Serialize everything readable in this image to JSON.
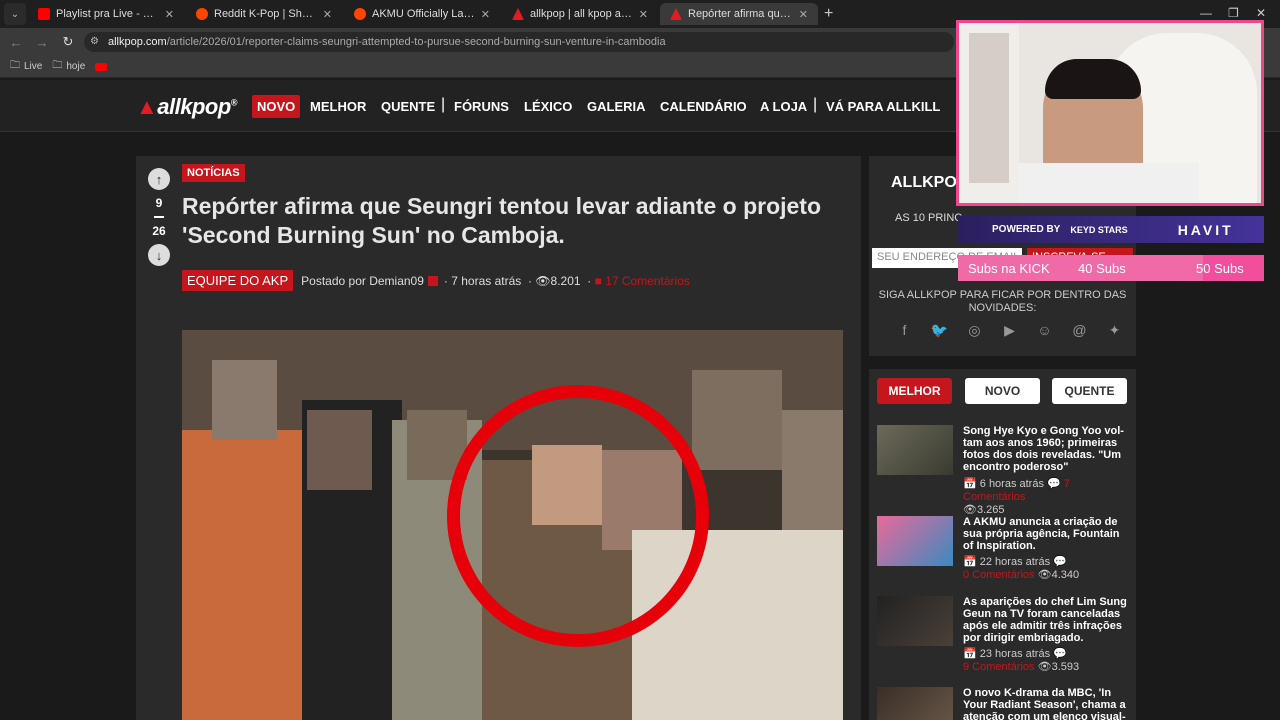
{
  "browser": {
    "tabs": [
      {
        "title": "Playlist pra Live - YouTube",
        "favicon_color": "#ff0000"
      },
      {
        "title": "Reddit K-Pop | Share and disco",
        "favicon_color": "#ff4500"
      },
      {
        "title": "AKMU Officially Launches One",
        "favicon_color": "#ff4500"
      },
      {
        "title": "allkpop | all kpop all the time",
        "favicon_color": "#e31b23"
      },
      {
        "title": "Repórter afirma que Seungri te",
        "favicon_color": "#e31b23"
      }
    ],
    "new_tab": "+",
    "url_domain": "allkpop.com",
    "url_path": "/article/2026/01/reporter-claims-seungri-attempted-to-pursue-second-burning-sun-venture-in-cambodia",
    "bookmarks": [
      {
        "label": "Live",
        "icon": "folder-icon"
      },
      {
        "label": "hoje",
        "icon": "folder-icon"
      },
      {
        "label": "",
        "icon": "youtube-icon"
      }
    ]
  },
  "site": {
    "logo": "allkpop",
    "nav": [
      "NOVO",
      "MELHOR",
      "QUENTE",
      "FÓRUNS",
      "LÉXICO",
      "GALERIA",
      "CALENDÁRIO",
      "A LOJA",
      "VÁ PARA ALLKILL"
    ],
    "accent": "#c4161c"
  },
  "article": {
    "category": "NOTÍCIAS",
    "votes_up": "9",
    "votes_down": "26",
    "title": "Repórter afirma que Seungri tentou levar adiante o projeto 'Second Burning Sun' no Camboja.",
    "team": "EQUIPE DO AKP",
    "posted_by": "Postado por Demian09",
    "time": "7 horas atrás",
    "views": "8.201",
    "comments": "17 Comentários"
  },
  "sidebar": {
    "newsletter_title": "ALLKPO",
    "newsletter_sub": "AS 10 PRINC",
    "email_placeholder": "SEU ENDEREÇO DE EMAIL",
    "subscribe": "INSCREVA-SE",
    "follow": "SIGA ALLKPOP PARA FICAR POR DENTRO DAS NOVIDADES:",
    "social_icons": [
      "facebook-icon",
      "twitter-icon",
      "instagram-icon",
      "youtube-icon",
      "discord-icon",
      "threads-icon",
      "bluesky-icon"
    ],
    "tabs": [
      "MELHOR",
      "NOVO",
      "QUENTE"
    ],
    "stories": [
      {
        "title": "Song Hye Kyo e Gong Yoo vol-tam aos anos 1960; primeiras fotos dos dois reveladas. \"Um encontro poderoso\"",
        "time": "6 horas atrás",
        "comments": "7 Comentários",
        "views": "3.265"
      },
      {
        "title": "A AKMU anuncia a criação de sua própria agência, Fountain of Inspiration.",
        "time": "22 horas atrás",
        "comments": "0 Comentários",
        "views": "4.340"
      },
      {
        "title": "As aparições do chef Lim Sung Geun na TV foram canceladas após ele admitir três infrações por dirigir embriagado.",
        "time": "23 horas atrás",
        "comments": "9 Comentários",
        "views": "3.593"
      },
      {
        "title": "O novo K-drama da MBC, 'In Your Radiant Season', chama a atenção com um elenco visual-",
        "time": "",
        "comments": "",
        "views": ""
      }
    ]
  },
  "stream_overlay": {
    "powered_by": "POWERED BY",
    "sponsor1": "KEYD STARS",
    "sponsor2": "HAVIT",
    "kick_label": "Subs na KICK",
    "kick_current": "40 Subs",
    "kick_goal": "50 Subs",
    "kick_progress": 0.8
  }
}
